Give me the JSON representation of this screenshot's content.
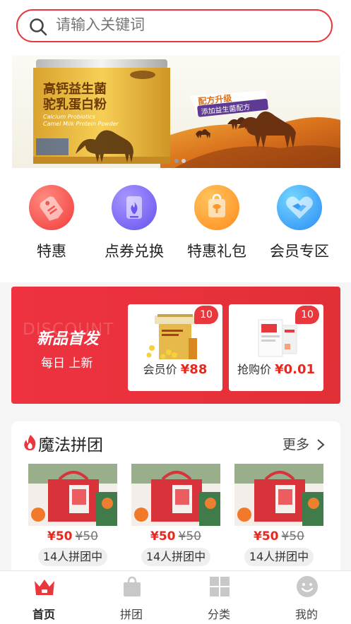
{
  "search": {
    "placeholder": "请输入关键词"
  },
  "banner": {
    "can_title_line1": "高钙益生菌",
    "can_title_line2": "驼乳蛋白粉",
    "can_subtitle_line1": "Calcium Probiotics",
    "can_subtitle_line2": "Camel Milk Protein Powder",
    "badge_line1": "配方升级",
    "badge_line2": "添加益生菌配方",
    "active_dot": 0,
    "dot_count": 2
  },
  "categories": [
    {
      "label": "特惠",
      "icon": "tag-icon",
      "color_start": "#ff7a6f",
      "color_end": "#f23b3b"
    },
    {
      "label": "点券兑换",
      "icon": "flame-coupon-icon",
      "color_start": "#a08cff",
      "color_end": "#6a57f2"
    },
    {
      "label": "特惠礼包",
      "icon": "gift-bag-icon",
      "color_start": "#ffc457",
      "color_end": "#ff8d1e"
    },
    {
      "label": "会员专区",
      "icon": "handshake-heart-icon",
      "color_start": "#6fd2ff",
      "color_end": "#2c8ef6"
    }
  ],
  "new_arrivals": {
    "watermark": "DISCOUNT",
    "title": "新品首发",
    "subtitle": "每日 上新",
    "cards": [
      {
        "tag": "10",
        "price_label": "会员价",
        "price": "¥88"
      },
      {
        "tag": "10",
        "price_label": "抢购价",
        "price": "¥0.01"
      }
    ]
  },
  "group_buy": {
    "title": "魔法拼团",
    "more": "更多",
    "items": [
      {
        "price": "¥50",
        "old_price": "¥50",
        "status": "14人拼团中"
      },
      {
        "price": "¥50",
        "old_price": "¥50",
        "status": "14人拼团中"
      },
      {
        "price": "¥50",
        "old_price": "¥50",
        "status": "14人拼团中"
      }
    ]
  },
  "tabbar": [
    {
      "label": "首页",
      "icon": "crown-home-icon",
      "active": true
    },
    {
      "label": "拼团",
      "icon": "shopping-bag-icon",
      "active": false
    },
    {
      "label": "分类",
      "icon": "grid-category-icon",
      "active": false
    },
    {
      "label": "我的",
      "icon": "smile-profile-icon",
      "active": false
    }
  ],
  "colors": {
    "accent": "#e8383d",
    "price": "#e8271f",
    "tab_inactive": "#c8c8c8"
  }
}
